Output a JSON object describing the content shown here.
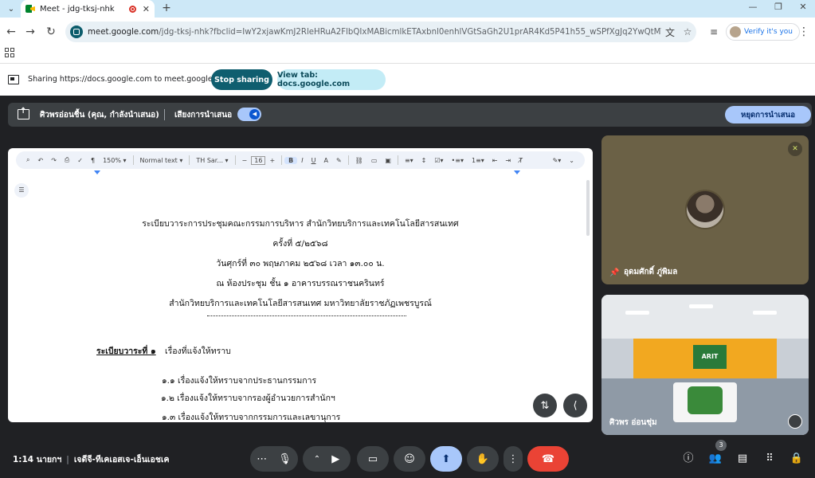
{
  "browser": {
    "tab_title": "Meet - jdg-tksj-nhk",
    "new_tab": "+",
    "url_host": "meet.google.com",
    "url_rest": "/jdg-tksj-nhk?fbclid=IwY2xjawKmJ2RleHRuA2FlbQIxMABicmlkETAxbnl0enhlVGtSaGh2U1prAR4Kd5P41h55_wSPfXgJq2YwQtMTvTczZFCSS-eZp...",
    "verify_label": "Verify it's you"
  },
  "share_banner": {
    "text": "Sharing https://docs.google.com to meet.google.com",
    "stop_label": "Stop sharing",
    "view_label": "View tab: docs.google.com"
  },
  "presenter": {
    "name": "ศิวพรอ่อนชื้น (คุณ, กำลังนำเสนอ)",
    "audio_label": "เสียงการนำเสนอ",
    "stop_label": "หยุดการนำเสนอ"
  },
  "doc_toolbar": {
    "zoom": "150%",
    "style": "Normal text",
    "font": "TH Sar...",
    "font_size": "16",
    "bold": "B",
    "italic": "I",
    "underline": "U"
  },
  "document": {
    "lines": [
      "ระเบียบวาระการประชุมคณะกรรมการบริหาร สำนักวิทยบริการและเทคโนโลยีสารสนเทศ",
      "ครั้งที่ ๕/๒๕๖๘",
      "วันศุกร์ที่ ๓๐ พฤษภาคม ๒๕๖๘ เวลา ๑๓.๐๐ น.",
      "ณ ห้องประชุม ชั้น ๑ อาคารบรรณราชนครินทร์",
      "สำนักวิทยบริการและเทคโนโลยีสารสนเทศ  มหาวิทยาลัยราชภัฏเพชรบูรณ์"
    ],
    "agenda_heading": "ระเบียบวาระที่ ๑",
    "agenda_title": "เรื่องที่แจ้งให้ทราบ",
    "items": [
      "๑.๑  เรื่องแจ้งให้ทราบจากประธานกรรมการ",
      "๑.๒  เรื่องแจ้งให้ทราบจากรองผู้อำนวยการสำนักฯ",
      "๑.๓  เรื่องแจ้งให้ทราบจากกรรมการและเลขานุการ"
    ]
  },
  "participants": [
    {
      "name": "อุดมศักดิ์ ภู่พิมล"
    },
    {
      "name": "ศิวพร อ่อนชุ่ม",
      "room_sign": "ARIT"
    }
  ],
  "bottom_bar": {
    "time": "1:14 นายกฯ",
    "meeting_code": "เจดีจี-ทีเคเอสเจ-เอ็นเอชเค",
    "people_count": "3"
  }
}
